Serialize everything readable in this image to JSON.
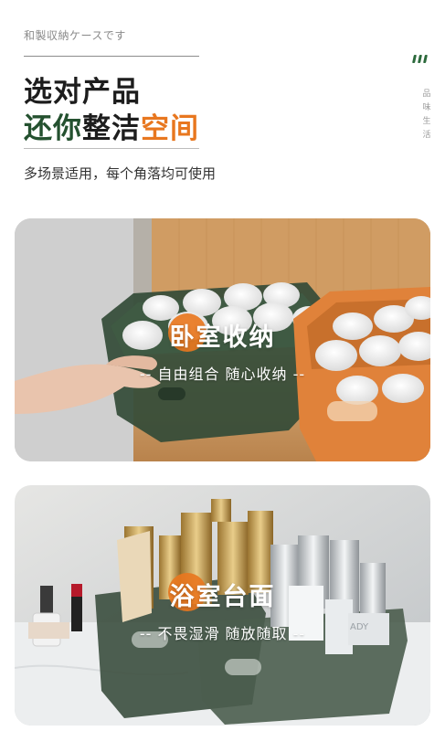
{
  "header": {
    "caption": "和製収納ケースです",
    "headline_line1": "选对产品",
    "headline_line2_green": "还你",
    "headline_line2_dark": "整洁",
    "headline_line2_orange": "空间",
    "subline": "多场景适用，每个角落均可使用"
  },
  "side_label": "品味生活",
  "colors": {
    "accent_green": "#24512f",
    "accent_orange": "#e8771f",
    "text_dark": "#1d1d1d"
  },
  "scenes": {
    "bedroom": {
      "title": "卧室收纳",
      "subtitle": "-- 自由组合  随心收纳 --"
    },
    "bathroom": {
      "title": "浴室台面",
      "subtitle": "-- 不畏湿滑  随放随取 --"
    }
  },
  "product_labels": {
    "tube_brand": "",
    "bottle_text": "ADY"
  }
}
